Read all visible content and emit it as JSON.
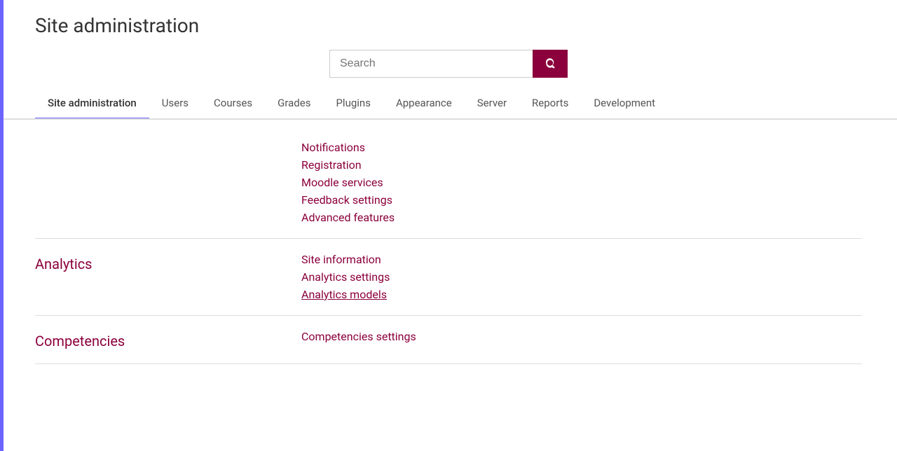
{
  "colors": {
    "accent_purple": "#6c63ff",
    "accent_red": "#8b003c",
    "border": "#ddd"
  },
  "header": {
    "title": "Site administration",
    "search_placeholder": "Search"
  },
  "nav": {
    "tabs": [
      {
        "label": "Site administration",
        "active": true
      },
      {
        "label": "Users",
        "active": false
      },
      {
        "label": "Courses",
        "active": false
      },
      {
        "label": "Grades",
        "active": false
      },
      {
        "label": "Plugins",
        "active": false
      },
      {
        "label": "Appearance",
        "active": false
      },
      {
        "label": "Server",
        "active": false
      },
      {
        "label": "Reports",
        "active": false
      },
      {
        "label": "Development",
        "active": false
      }
    ]
  },
  "sections": [
    {
      "id": "site-admin-top",
      "title": "",
      "links": [
        {
          "label": "Notifications",
          "current": false
        },
        {
          "label": "Registration",
          "current": false
        },
        {
          "label": "Moodle services",
          "current": false
        },
        {
          "label": "Feedback settings",
          "current": false
        },
        {
          "label": "Advanced features",
          "current": false
        }
      ]
    },
    {
      "id": "analytics",
      "title": "Analytics",
      "links": [
        {
          "label": "Site information",
          "current": false
        },
        {
          "label": "Analytics settings",
          "current": false
        },
        {
          "label": "Analytics models",
          "current": true
        }
      ]
    },
    {
      "id": "competencies",
      "title": "Competencies",
      "links": [
        {
          "label": "Competencies settings",
          "current": false
        }
      ]
    }
  ],
  "icons": {
    "search": "🔍"
  }
}
